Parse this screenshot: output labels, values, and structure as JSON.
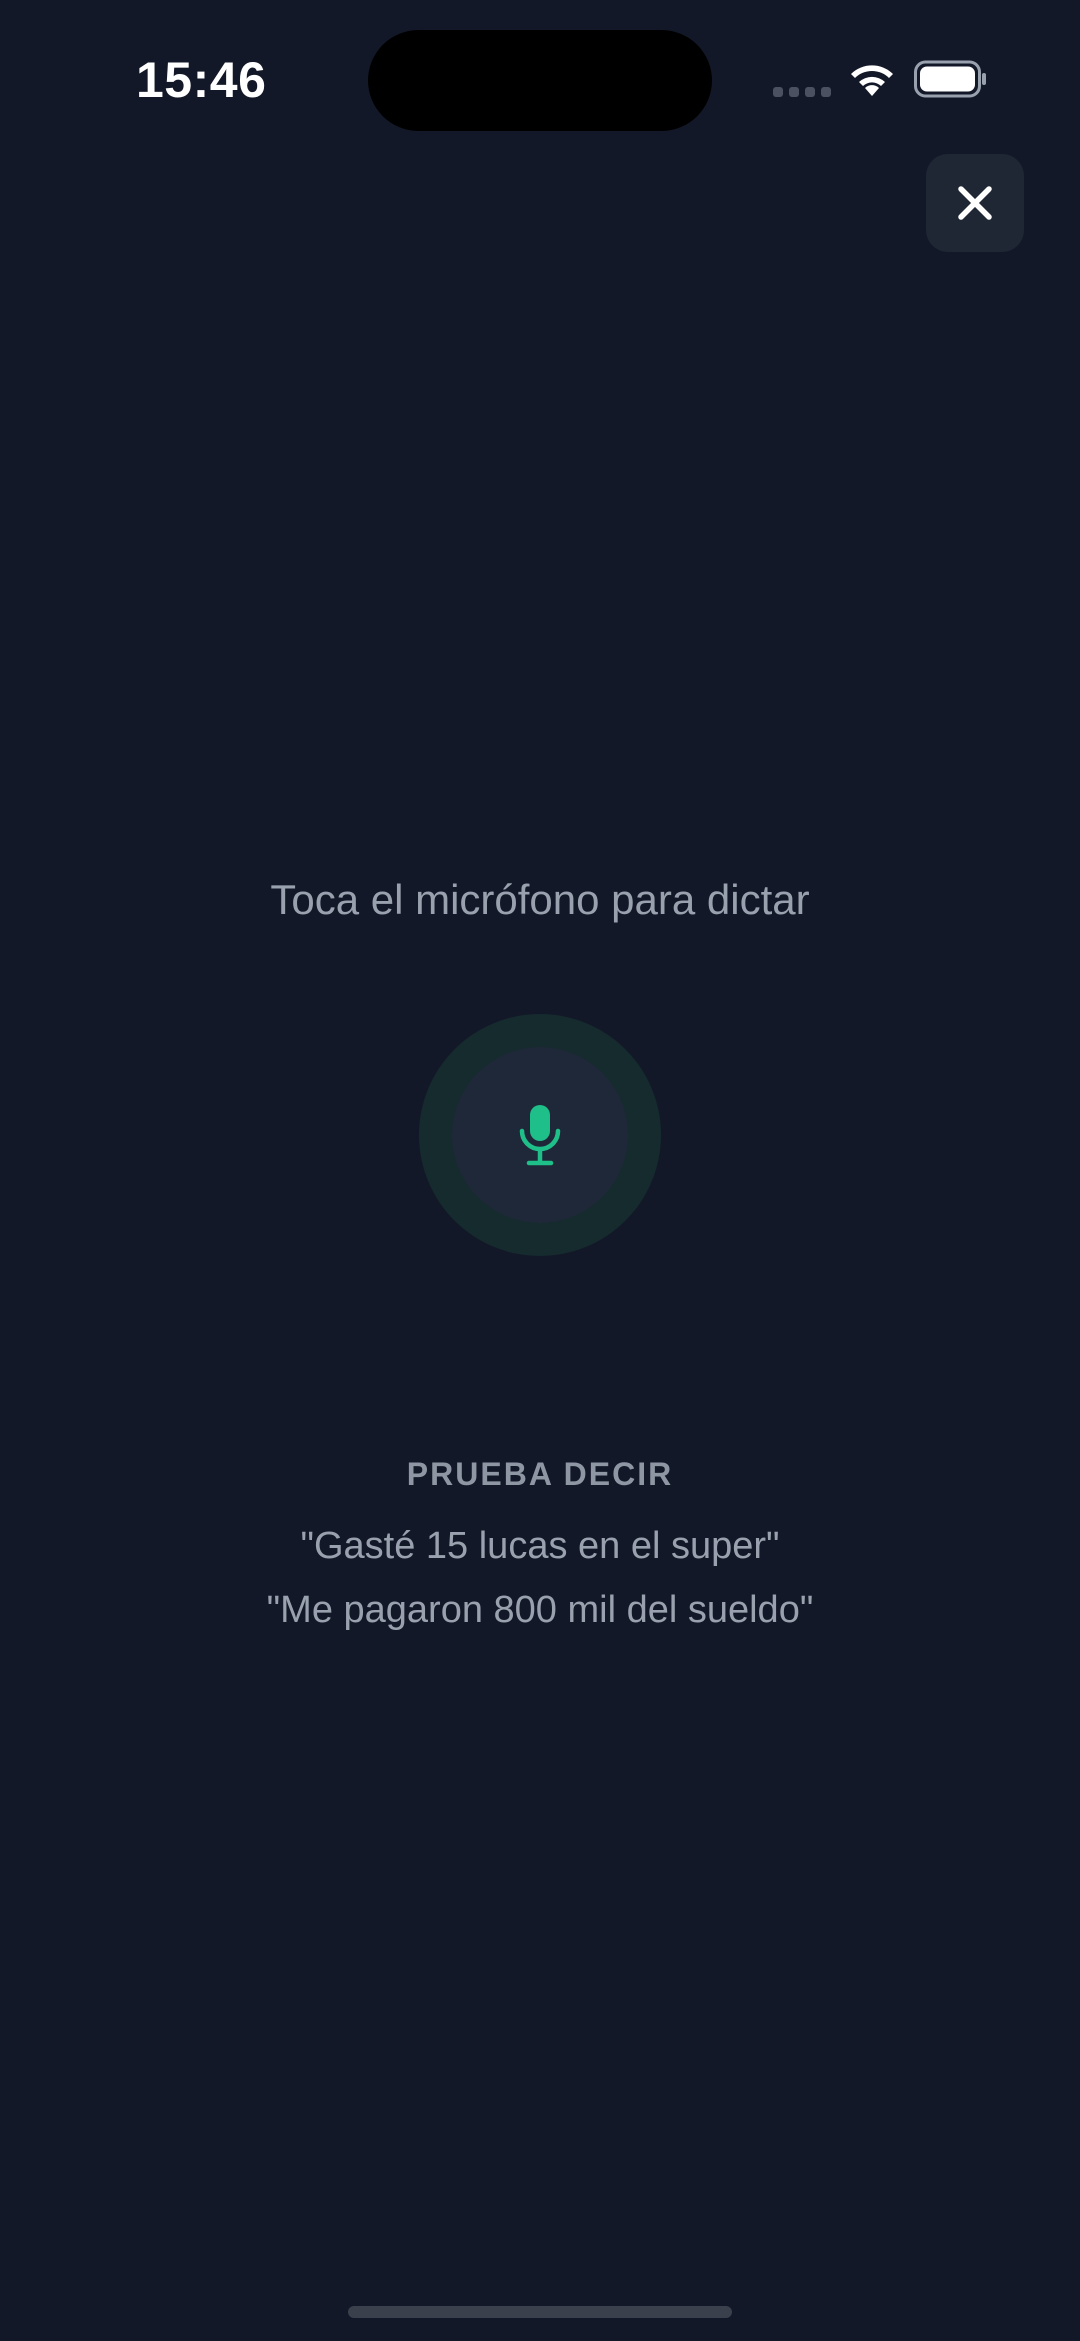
{
  "status_bar": {
    "time": "15:46",
    "icons": [
      "cellular-signal-icon",
      "wifi-icon",
      "battery-icon"
    ]
  },
  "close_button": {
    "icon": "close-icon"
  },
  "instruction": "Toca el micrófono para dictar",
  "mic_button": {
    "icon": "microphone-icon",
    "accent_color": "#1fbf8a"
  },
  "suggestions": {
    "label": "PRUEBA DECIR",
    "examples": [
      "\"Gasté 15 lucas en el super\"",
      "\"Me pagaron 800 mil del sueldo\""
    ]
  },
  "colors": {
    "background": "#131828",
    "surface": "#1f2735",
    "text_muted": "#9aa1ae",
    "accent": "#1fbf8a"
  }
}
